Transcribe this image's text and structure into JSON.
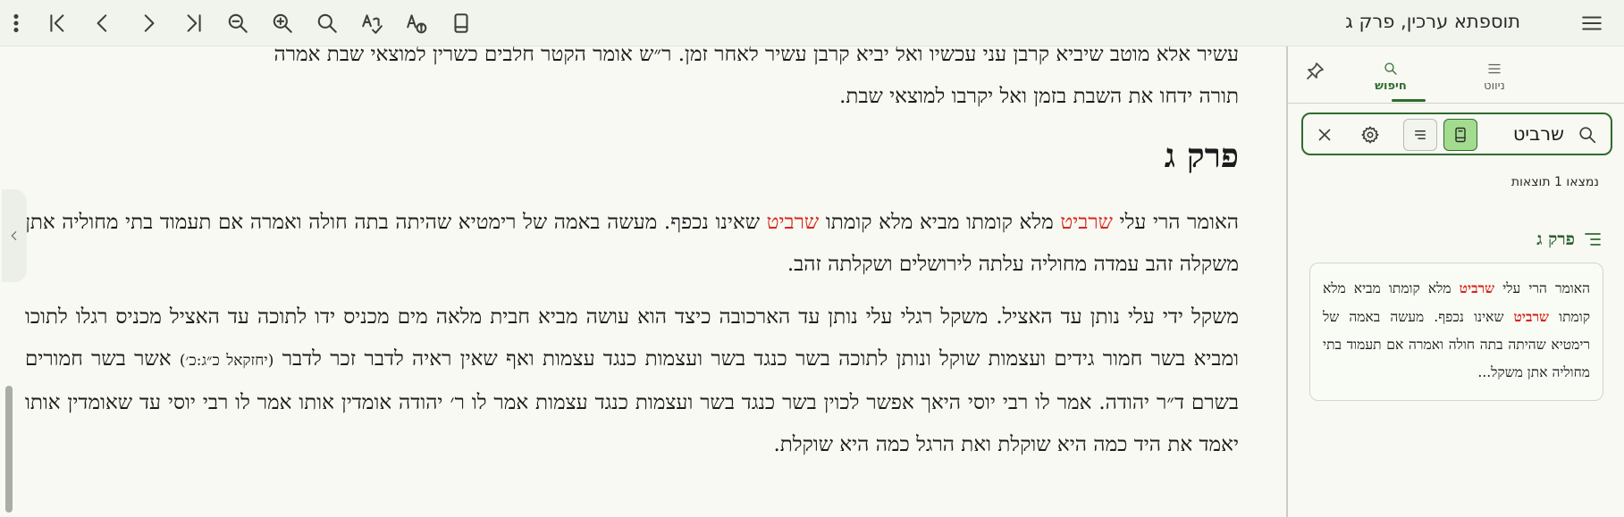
{
  "toolbar": {
    "title": "תוספתא ערכין, פרק ג",
    "buttons": [
      "more-vert",
      "first-page",
      "previous",
      "next",
      "last-page",
      "zoom-out",
      "zoom-in",
      "search",
      "spellcheck-font",
      "font-info",
      "book"
    ]
  },
  "content": {
    "top_lines": [
      "עשיר אלא מוטב שיביא קרבן עני עכשיו ואל יביא קרבן עשיר לאחר זמן. ר״ש אומר הקטר חלבים כשרין למוצאי שבת אמרה",
      "תורה ידחו את השבת בזמן ואל יקרבו למוצאי שבת."
    ],
    "heading": "פרק ג",
    "para1_a": "האומר הרי עלי ",
    "para1_hl1": "שרביט",
    "para1_b": " מלא קומתו מביא מלא קומתו ",
    "para1_hl2": "שרביט",
    "para1_c": " שאינו נכפף. מעשה באמה של רימטיא שהיתה בתה חולה ואמרה אם תעמוד בתי מחוליה אתן משקלה זהב עמדה מחוליה עלתה לירושלים ושקלתה זהב.",
    "para2": "משקל ידי עלי נותן עד האציל. משקל רגלי עלי נותן עד הארכובה כיצד הוא עושה מביא חבית מלאה מים מכניס ידו לתוכה עד האציל מכניס רגלו לתוכו ומביא בשר חמור גידים ועצמות שוקל ונותן לתוכה בשר כנגד בשר ועצמות כנגד עצמות ואף שאין ראיה לדבר זכר לדבר ",
    "para2_ref": "(יחזקאל כ״ג:כ׳)",
    "para2_b": " אשר בשר חמורים בשרם ד״ר יהודה. אמר לו רבי יוסי היאך אפשר לכוין בשר כנגד בשר ועצמות כנגד עצמות אמר לו ר׳ יהודה אומדין אותו אמר לו רבי יוסי עד שאומדין אותו יאמד את היד כמה היא שוקלת ואת הרגל כמה היא שוקלת."
  },
  "side_panel": {
    "tabs": [
      {
        "label": "ניווט",
        "icon": "menu-icon"
      },
      {
        "label": "חיפוש",
        "icon": "search-icon",
        "active": true
      }
    ],
    "search": {
      "query": "שרביט"
    },
    "results_count": "נמצאו 1 תוצאות",
    "result_group": "פרק ג",
    "result_a": "האומר הרי עלי ",
    "result_hl1": "שרביט",
    "result_b": " מלא קומתו מביא מלא קומתו ",
    "result_hl2": "שרביט",
    "result_c": " שאינו נכפף. מעשה באמה של רימטיא שהיתה בתה חולה ואמרה אם תעמוד בתי מחוליה אתן משקל..."
  },
  "colors": {
    "highlight": "#d9261c",
    "accent": "#2f6b30",
    "toggle_on": "#a4dc8f"
  }
}
